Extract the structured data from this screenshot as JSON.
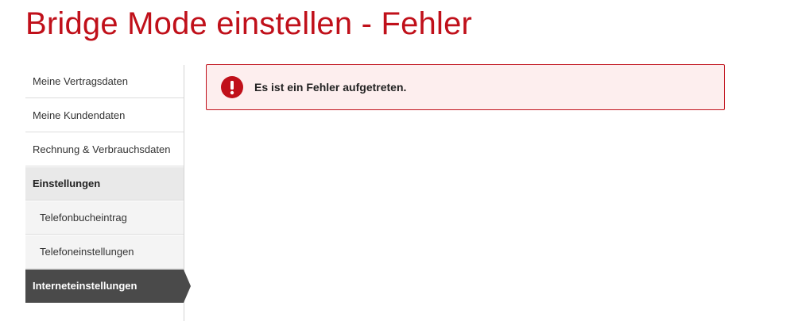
{
  "page": {
    "title": "Bridge Mode einstellen - Fehler"
  },
  "sidebar": {
    "items": [
      {
        "label": "Meine Vertragsdaten",
        "type": "top"
      },
      {
        "label": "Meine Kundendaten",
        "type": "top"
      },
      {
        "label": "Rechnung & Verbrauchsdaten",
        "type": "top"
      },
      {
        "label": "Einstellungen",
        "type": "section"
      },
      {
        "label": "Telefonbucheintrag",
        "type": "sub"
      },
      {
        "label": "Telefoneinstellungen",
        "type": "sub"
      },
      {
        "label": "Interneteinstellungen",
        "type": "active"
      }
    ]
  },
  "alert": {
    "message": "Es ist ein Fehler aufgetreten.",
    "icon": "error-exclamation-icon",
    "accent_color": "#c0101a",
    "background_color": "#fdeeee"
  }
}
